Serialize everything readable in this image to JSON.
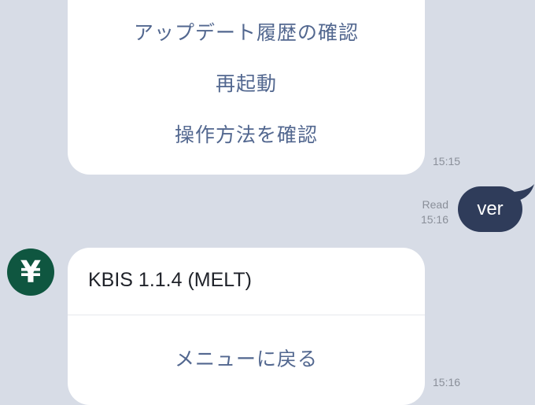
{
  "messages": {
    "menu_card": {
      "buttons": [
        "アップデート履歴の確認",
        "再起動",
        "操作方法を確認"
      ],
      "time": "15:15"
    },
    "outgoing": {
      "read_label": "Read",
      "time": "15:16",
      "text": "ver"
    },
    "bot_reply": {
      "avatar_glyph": "¥",
      "text": "KBIS 1.1.4 (MELT)",
      "button": "メニューに戻る",
      "time": "15:16"
    }
  },
  "colors": {
    "background": "#d7dce6",
    "outgoing_bubble": "#2f3c5a",
    "link_text": "#52678f",
    "avatar": "#0f5640"
  }
}
